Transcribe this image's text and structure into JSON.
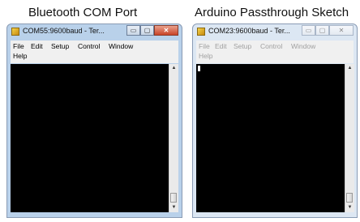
{
  "captions": {
    "left": "Bluetooth COM Port",
    "right": "Arduino Passthrough Sketch"
  },
  "window_left": {
    "title": "COM55:9600baud - Ter...",
    "controls": {
      "minimize": "▭",
      "maximize": "▢",
      "close": "✕"
    },
    "menu": [
      "File",
      "Edit",
      "Setup",
      "Control",
      "Window",
      "Help"
    ]
  },
  "window_right": {
    "title": "COM23:9600baud - Ter...",
    "controls": {
      "minimize": "▭",
      "maximize": "▢",
      "close": "✕"
    },
    "menu": [
      "File",
      "Edit",
      "Setup",
      "Control",
      "Window",
      "Help"
    ]
  },
  "scroll_arrows": {
    "up": "▲",
    "down": "▼"
  },
  "colors": {
    "terminal_bg": "#000000",
    "active_frame": "#b9d1ea",
    "inactive_frame": "#dce7f3",
    "close_button": "#c84428"
  }
}
